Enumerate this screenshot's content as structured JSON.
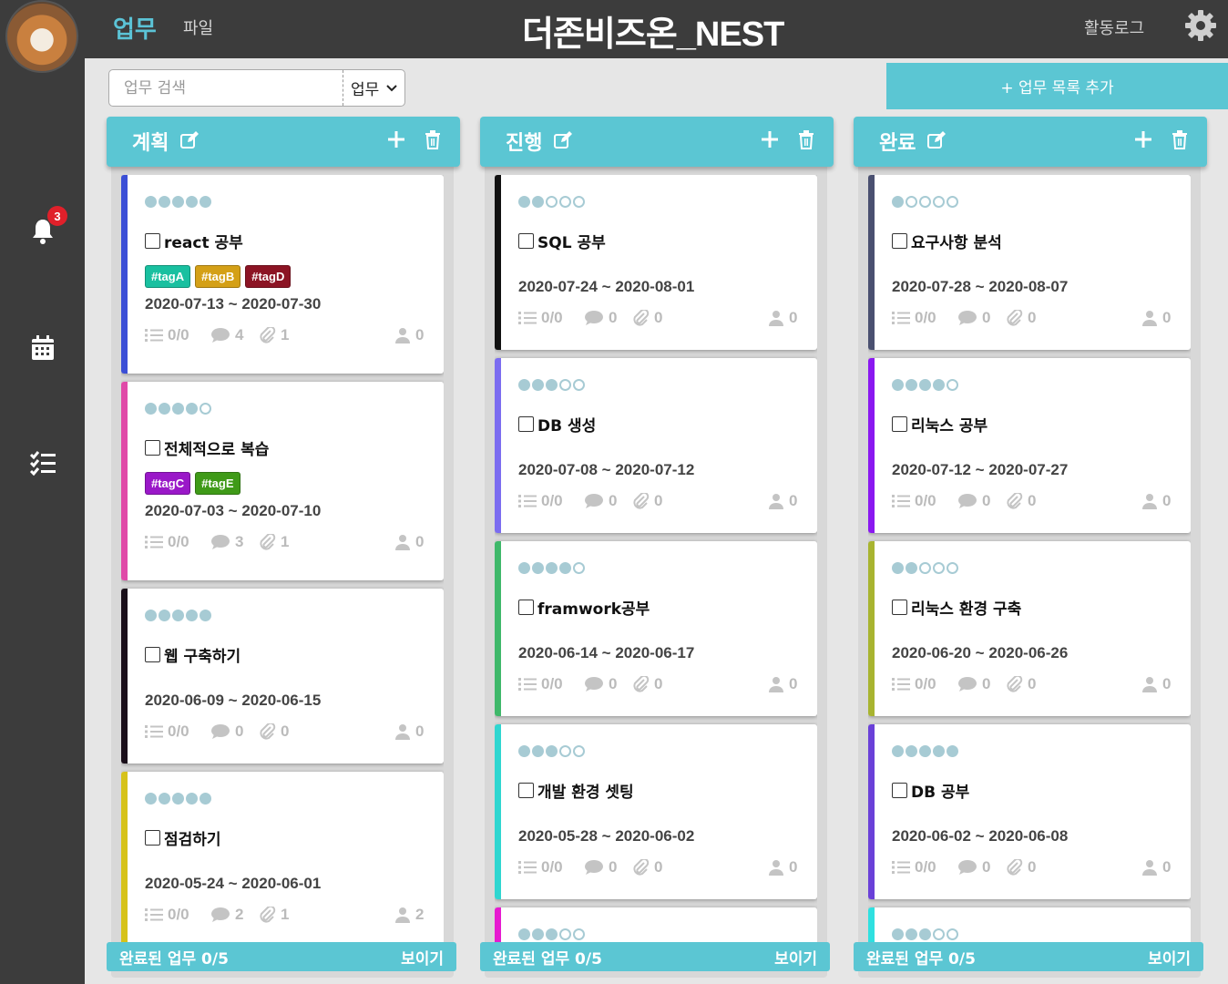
{
  "header": {
    "nav_work": "업무",
    "nav_file": "파일",
    "app_title": "더존비즈온_NEST",
    "activity_log": "활동로그"
  },
  "sidebar": {
    "notification_count": "3",
    "icons": [
      "bell-icon",
      "calendar-icon",
      "checklist-icon",
      "gear-icon"
    ]
  },
  "toolbar": {
    "search_placeholder": "업무 검색",
    "search_type": "업무",
    "add_list_label": "+ 업무 목록 추가"
  },
  "colors": {
    "accent": "#5bc6d3",
    "dark": "#3c3c3c"
  },
  "columns": [
    {
      "title": "계획",
      "done_label": "완료된 업무 0/5",
      "show_label": "보이기",
      "cards": [
        {
          "stars": 5,
          "stripe": "#3b4fd6",
          "name": "react 공부",
          "tags": [
            {
              "label": "#tagA",
              "color": "#19c0a0"
            },
            {
              "label": "#tagB",
              "color": "#d4a017"
            },
            {
              "label": "#tagD",
              "color": "#8c1424"
            }
          ],
          "dates": "2020-07-13 ~ 2020-07-30",
          "checklist": "0/0",
          "comments": "4",
          "files": "1",
          "members": "0"
        },
        {
          "stars": 4,
          "stripe": "#e04aa8",
          "name": "전체적으로 복습",
          "tags": [
            {
              "label": "#tagC",
              "color": "#9a18c8"
            },
            {
              "label": "#tagE",
              "color": "#3f9a18"
            }
          ],
          "dates": "2020-07-03 ~ 2020-07-10",
          "checklist": "0/0",
          "comments": "3",
          "files": "1",
          "members": "0"
        },
        {
          "stars": 5,
          "stripe": "#1a0f1a",
          "name": "웹 구축하기",
          "tags": [],
          "dates": "2020-06-09 ~ 2020-06-15",
          "checklist": "0/0",
          "comments": "0",
          "files": "0",
          "members": "0"
        },
        {
          "stars": 5,
          "stripe": "#d6c21a",
          "name": "점검하기",
          "tags": [],
          "dates": "2020-05-24 ~ 2020-06-01",
          "checklist": "0/0",
          "comments": "2",
          "files": "1",
          "members": "2"
        }
      ]
    },
    {
      "title": "진행",
      "done_label": "완료된 업무 0/5",
      "show_label": "보이기",
      "cards": [
        {
          "stars": 2,
          "stripe": "#111111",
          "name": "SQL 공부",
          "tags": [],
          "dates": "2020-07-24 ~ 2020-08-01",
          "checklist": "0/0",
          "comments": "0",
          "files": "0",
          "members": "0"
        },
        {
          "stars": 3,
          "stripe": "#7b6cf0",
          "name": "DB 생성",
          "tags": [],
          "dates": "2020-07-08 ~ 2020-07-12",
          "checklist": "0/0",
          "comments": "0",
          "files": "0",
          "members": "0"
        },
        {
          "stars": 4,
          "stripe": "#3fb86a",
          "name": "framwork공부",
          "tags": [],
          "dates": "2020-06-14 ~ 2020-06-17",
          "checklist": "0/0",
          "comments": "0",
          "files": "0",
          "members": "0"
        },
        {
          "stars": 3,
          "stripe": "#2fd6d0",
          "name": "개발 환경 셋팅",
          "tags": [],
          "dates": "2020-05-28 ~ 2020-06-02",
          "checklist": "0/0",
          "comments": "0",
          "files": "0",
          "members": "0"
        },
        {
          "stars": 3,
          "stripe": "#e61ad0",
          "name": "",
          "tags": [],
          "dates": "",
          "checklist": "",
          "comments": "",
          "files": "",
          "members": ""
        }
      ]
    },
    {
      "title": "완료",
      "done_label": "완료된 업무 0/5",
      "show_label": "보이기",
      "cards": [
        {
          "stars": 1,
          "stripe": "#4a5070",
          "name": "요구사항 분석",
          "tags": [],
          "dates": "2020-07-28 ~ 2020-08-07",
          "checklist": "0/0",
          "comments": "0",
          "files": "0",
          "members": "0"
        },
        {
          "stars": 4,
          "stripe": "#8a18f0",
          "name": "리눅스 공부",
          "tags": [],
          "dates": "2020-07-12 ~ 2020-07-27",
          "checklist": "0/0",
          "comments": "0",
          "files": "0",
          "members": "0"
        },
        {
          "stars": 2,
          "stripe": "#a8b430",
          "name": "리눅스 환경 구축",
          "tags": [],
          "dates": "2020-06-20 ~ 2020-06-26",
          "checklist": "0/0",
          "comments": "0",
          "files": "0",
          "members": "0"
        },
        {
          "stars": 5,
          "stripe": "#6a40d8",
          "name": "DB 공부",
          "tags": [],
          "dates": "2020-06-02 ~ 2020-06-08",
          "checklist": "0/0",
          "comments": "0",
          "files": "0",
          "members": "0"
        },
        {
          "stars": 3,
          "stripe": "#2fe0e0",
          "name": "",
          "tags": [],
          "dates": "",
          "checklist": "",
          "comments": "",
          "files": "",
          "members": ""
        }
      ]
    }
  ]
}
